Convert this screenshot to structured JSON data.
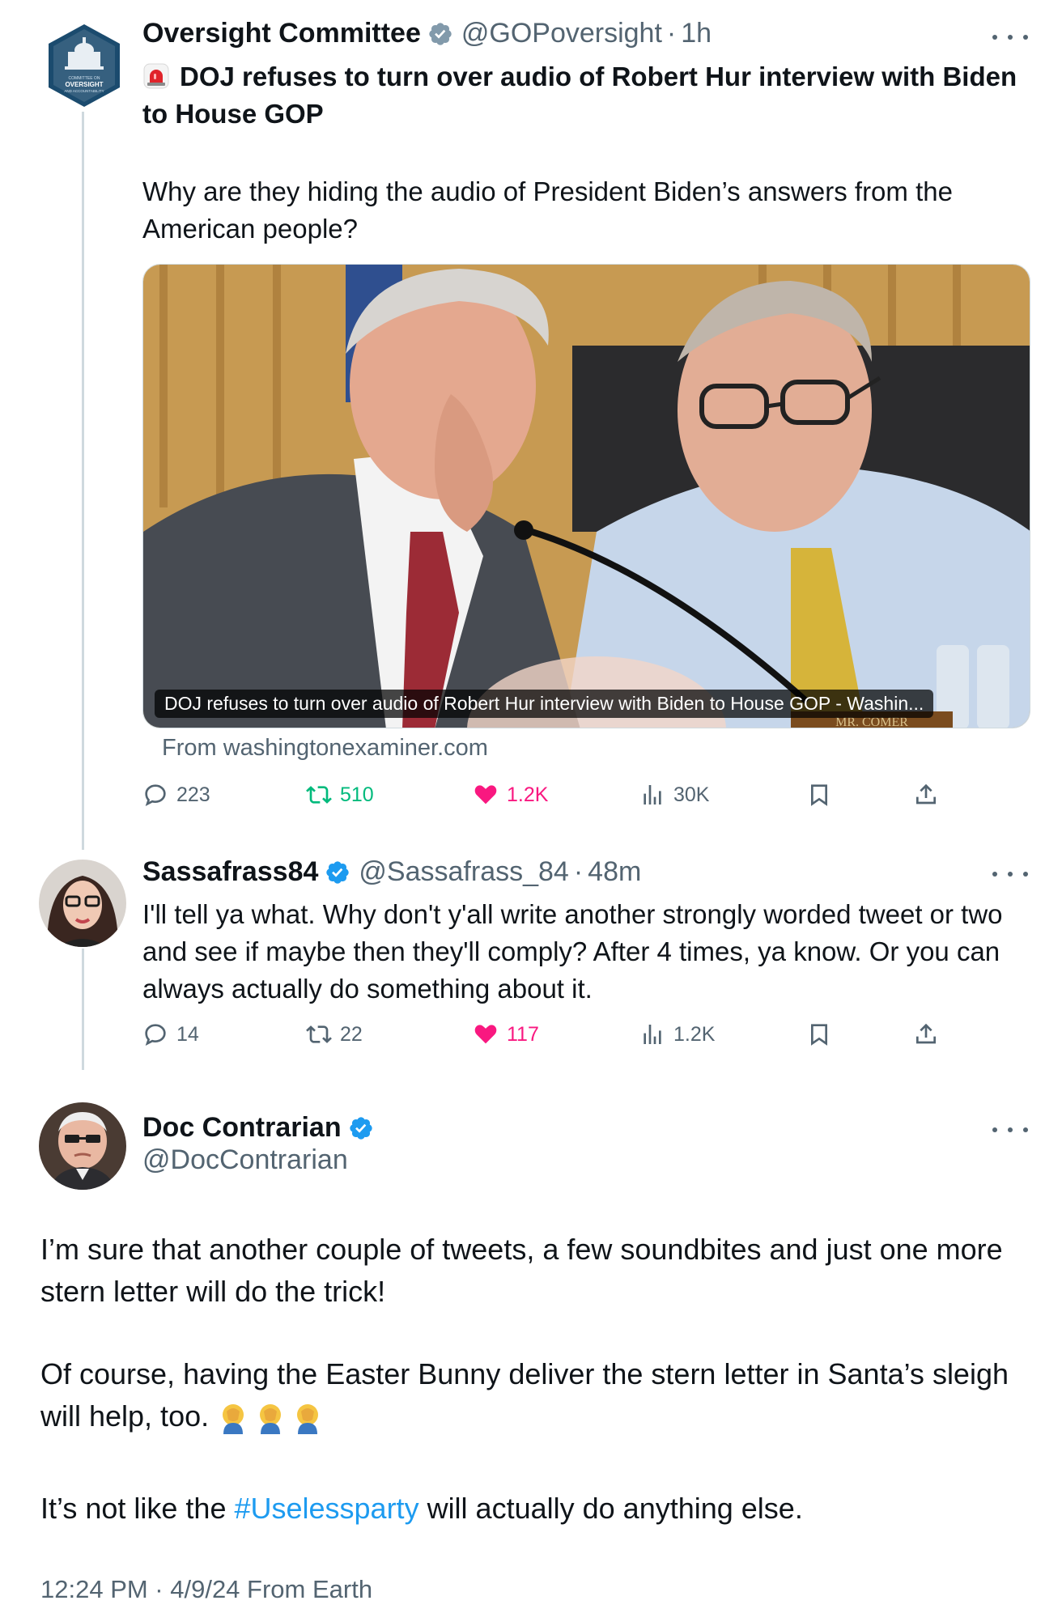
{
  "tweet1": {
    "name": "Oversight Committee",
    "handle": "@GOPoversight",
    "separator": "·",
    "time": "1h",
    "headline": "DOJ refuses to turn over audio of Robert Hur interview with Biden to House GOP",
    "body": "Why are they hiding the audio of President Biden’s answers from the American people?",
    "avatar_text": [
      "COMMITTEE ON",
      "OVERSIGHT",
      "AND ACCOUNTABILITY"
    ],
    "card_caption": "DOJ refuses to turn over audio of Robert Hur interview with Biden to House GOP - Washin...",
    "card_source": "From washingtonexaminer.com",
    "nameplate": "MR. COMER",
    "actions": {
      "replies": "223",
      "retweets": "510",
      "likes": "1.2K",
      "views": "30K"
    }
  },
  "tweet2": {
    "name": "Sassafrass84",
    "handle": "@Sassafrass_84",
    "separator": "·",
    "time": "48m",
    "body": "I'll tell ya what. Why don't y'all write another strongly worded tweet or two and see if maybe then they'll comply? After 4 times, ya know. Or you can always actually do something about it.",
    "actions": {
      "replies": "14",
      "retweets": "22",
      "likes": "117",
      "views": "1.2K"
    }
  },
  "tweet3": {
    "name": "Doc Contrarian",
    "handle": "@DocContrarian",
    "para1": "I’m sure that another couple of tweets, a few soundbites and just one more stern letter will do the trick!",
    "para2": "Of course, having the Easter Bunny deliver the stern letter in Santa’s sleigh will help, too.",
    "para3_pre": "It’s not like the ",
    "hashtag": "#Uselessparty",
    "para3_post": " will actually do anything else.",
    "footer": "12:24 PM · 4/9/24 From Earth"
  },
  "colors": {
    "text": "#0f1419",
    "secondary": "#536471",
    "verified": "#1d9bf0",
    "retweet": "#00ba7c",
    "like": "#f91880",
    "gov_badge": "#829aab"
  },
  "icons": [
    "siren-icon",
    "verified-badge-icon",
    "more-icon",
    "reply-icon",
    "retweet-icon",
    "like-icon",
    "views-icon",
    "bookmark-icon",
    "share-icon",
    "facepalm-icon"
  ]
}
